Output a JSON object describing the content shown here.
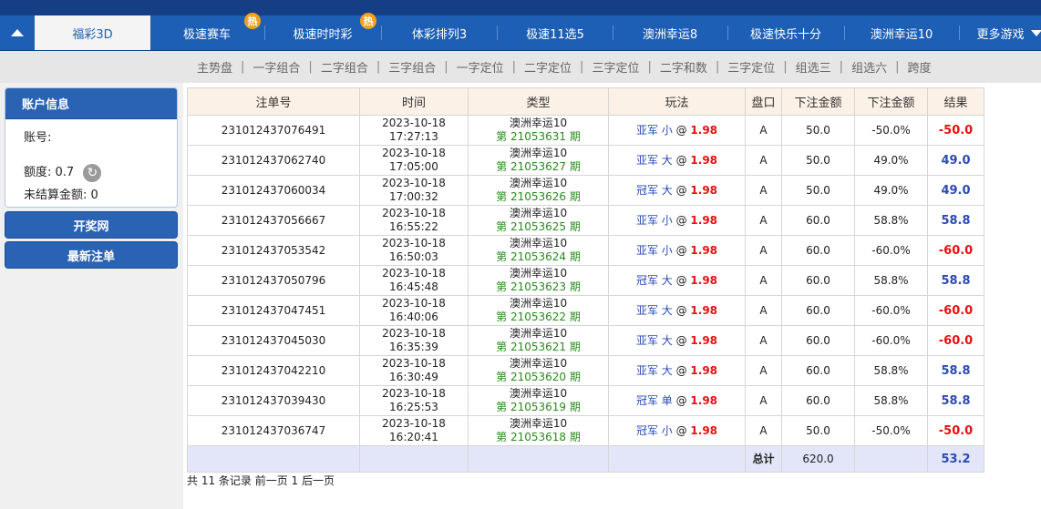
{
  "nav": {
    "tabs": [
      {
        "label": "福彩3D",
        "active": true
      },
      {
        "label": "极速赛车",
        "hot": true
      },
      {
        "label": "极速时时彩",
        "hot": true
      },
      {
        "label": "体彩排列3"
      },
      {
        "label": "极速11选5"
      },
      {
        "label": "澳洲幸运8"
      },
      {
        "label": "极速快乐十分"
      },
      {
        "label": "澳洲幸运10"
      },
      {
        "label": "更多游戏"
      }
    ],
    "hot_badge": "热"
  },
  "subnav": {
    "items": [
      "主势盘",
      "一字组合",
      "二字组合",
      "三字组合",
      "一字定位",
      "二字定位",
      "三字定位",
      "二字和数",
      "三字定位",
      "组选三",
      "组选六",
      "跨度"
    ]
  },
  "sidebar": {
    "account_title": "账户信息",
    "account_label": "账号:",
    "account_value": "",
    "limit_label": "额度: ",
    "limit_value": "0.7",
    "unsettled_label": "未结算金额: ",
    "unsettled_value": "0",
    "draw_button": "开奖网",
    "latest_button": "最新注单"
  },
  "table": {
    "headers": [
      "注单号",
      "时间",
      "类型",
      "玩法",
      "盘口",
      "下注金额",
      "下注金额",
      "结果"
    ],
    "rows": [
      {
        "id": "231012437076491",
        "date": "2023-10-18",
        "time": "17:27:13",
        "game": "澳洲幸运10",
        "period": "第 21053631 期",
        "play": "亚军 小",
        "odds": "1.98",
        "pan": "A",
        "amount": "50.0",
        "rate": "-50.0%",
        "result": "-50.0"
      },
      {
        "id": "231012437062740",
        "date": "2023-10-18",
        "time": "17:05:00",
        "game": "澳洲幸运10",
        "period": "第 21053627 期",
        "play": "亚军 大",
        "odds": "1.98",
        "pan": "A",
        "amount": "50.0",
        "rate": "49.0%",
        "result": "49.0"
      },
      {
        "id": "231012437060034",
        "date": "2023-10-18",
        "time": "17:00:32",
        "game": "澳洲幸运10",
        "period": "第 21053626 期",
        "play": "冠军 大",
        "odds": "1.98",
        "pan": "A",
        "amount": "50.0",
        "rate": "49.0%",
        "result": "49.0"
      },
      {
        "id": "231012437056667",
        "date": "2023-10-18",
        "time": "16:55:22",
        "game": "澳洲幸运10",
        "period": "第 21053625 期",
        "play": "亚军 小",
        "odds": "1.98",
        "pan": "A",
        "amount": "60.0",
        "rate": "58.8%",
        "result": "58.8"
      },
      {
        "id": "231012437053542",
        "date": "2023-10-18",
        "time": "16:50:03",
        "game": "澳洲幸运10",
        "period": "第 21053624 期",
        "play": "亚军 小",
        "odds": "1.98",
        "pan": "A",
        "amount": "60.0",
        "rate": "-60.0%",
        "result": "-60.0"
      },
      {
        "id": "231012437050796",
        "date": "2023-10-18",
        "time": "16:45:48",
        "game": "澳洲幸运10",
        "period": "第 21053623 期",
        "play": "冠军 大",
        "odds": "1.98",
        "pan": "A",
        "amount": "60.0",
        "rate": "58.8%",
        "result": "58.8"
      },
      {
        "id": "231012437047451",
        "date": "2023-10-18",
        "time": "16:40:06",
        "game": "澳洲幸运10",
        "period": "第 21053622 期",
        "play": "亚军 大",
        "odds": "1.98",
        "pan": "A",
        "amount": "60.0",
        "rate": "-60.0%",
        "result": "-60.0"
      },
      {
        "id": "231012437045030",
        "date": "2023-10-18",
        "time": "16:35:39",
        "game": "澳洲幸运10",
        "period": "第 21053621 期",
        "play": "亚军 大",
        "odds": "1.98",
        "pan": "A",
        "amount": "60.0",
        "rate": "-60.0%",
        "result": "-60.0"
      },
      {
        "id": "231012437042210",
        "date": "2023-10-18",
        "time": "16:30:49",
        "game": "澳洲幸运10",
        "period": "第 21053620 期",
        "play": "亚军 大",
        "odds": "1.98",
        "pan": "A",
        "amount": "60.0",
        "rate": "58.8%",
        "result": "58.8"
      },
      {
        "id": "231012437039430",
        "date": "2023-10-18",
        "time": "16:25:53",
        "game": "澳洲幸运10",
        "period": "第 21053619 期",
        "play": "冠军 单",
        "odds": "1.98",
        "pan": "A",
        "amount": "60.0",
        "rate": "58.8%",
        "result": "58.8"
      },
      {
        "id": "231012437036747",
        "date": "2023-10-18",
        "time": "16:20:41",
        "game": "澳洲幸运10",
        "period": "第 21053618 期",
        "play": "冠军 小",
        "odds": "1.98",
        "pan": "A",
        "amount": "50.0",
        "rate": "-50.0%",
        "result": "-50.0"
      }
    ],
    "total_label": "总计",
    "total_amount": "620.0",
    "total_result": "53.2"
  },
  "pager": {
    "text": "共 11 条记录 前一页 1 后一页"
  }
}
